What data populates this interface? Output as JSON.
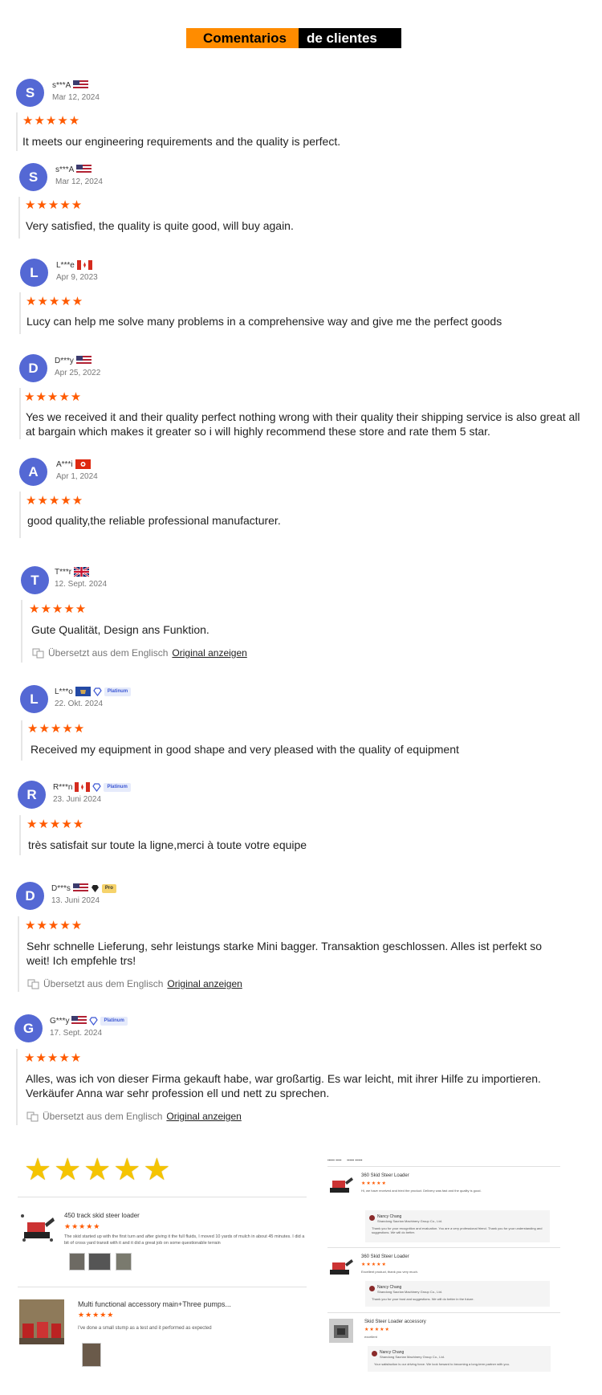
{
  "header": {
    "part1": "Comentarios",
    "part2": "de clientes"
  },
  "reviews": [
    {
      "initial": "S",
      "name": "s***A",
      "date": "Mar 12, 2024",
      "stars": "★★★★★",
      "text": "It meets our engineering requirements and the quality is perfect."
    },
    {
      "initial": "S",
      "name": "s***A",
      "date": "Mar 12, 2024",
      "stars": "★★★★★",
      "text": "Very satisfied, the quality is quite good, will buy again."
    },
    {
      "initial": "L",
      "name": "L***e",
      "date": "Apr 9, 2023",
      "stars": "★★★★★",
      "text": "Lucy can help me solve many problems in a comprehensive way and give me the perfect goods"
    },
    {
      "initial": "D",
      "name": "D***y",
      "date": "Apr 25, 2022",
      "stars": "★★★★★",
      "text": "Yes we received it and their quality perfect nothing wrong with their quality their shipping service is also great all at bargain which makes it greater so i will highly recommend these store and rate them 5 star."
    },
    {
      "initial": "A",
      "name": "A***i",
      "date": "Apr 1, 2024",
      "stars": "★★★★★",
      "text": "good quality,the reliable professional manufacturer."
    },
    {
      "initial": "T",
      "name": "T***r",
      "date": "12. Sept. 2024",
      "stars": "★★★★★",
      "text": "Gute Qualität, Design ans Funktion.",
      "translated": "Übersetzt aus dem Englisch",
      "original_link": "Original anzeigen"
    },
    {
      "initial": "L",
      "name": "L***o",
      "badge": "Platinum",
      "date": "22. Okt. 2024",
      "stars": "★★★★★",
      "text": "Received my equipment in good shape and very pleased with the quality of equipment"
    },
    {
      "initial": "R",
      "name": "R***n",
      "badge": "Platinum",
      "date": "23. Juni 2024",
      "stars": "★★★★★",
      "text": "très satisfait sur toute la ligne,merci à toute votre equipe"
    },
    {
      "initial": "D",
      "name": "D***s",
      "badge": "Pro",
      "date": "13. Juni 2024",
      "stars": "★★★★★",
      "text": "Sehr schnelle Lieferung, sehr leistungs starke Mini bagger. Transaktion geschlossen. Alles ist perfekt so weit! Ich empfehle trs!",
      "translated": "Übersetzt aus dem Englisch",
      "original_link": "Original anzeigen"
    },
    {
      "initial": "G",
      "name": "G***y",
      "badge": "Platinum",
      "date": "17. Sept. 2024",
      "stars": "★★★★★",
      "text": "Alles, was ich von dieser Firma gekauft habe, war großartig. Es war leicht, mit ihrer Hilfe zu importieren. Verkäufer Anna war sehr profession ell und nett zu sprechen.",
      "translated": "Übersetzt aus dem Englisch",
      "original_link": "Original anzeigen"
    }
  ],
  "colors": {
    "accent_orange": "#ff8c00",
    "star_orange": "#ff5a00",
    "avatar_blue": "#5468d4",
    "big_star_gold": "#f5c400"
  },
  "bottom_left": {
    "big_stars": "★★★★★",
    "items": [
      {
        "title": "450 track skid steer loader",
        "stars": "★★★★★",
        "desc": "The skid started up with the first turn and after giving it the full fluids, I moved 10 yards of mulch in about 45 minutes. I did a bit of cross yard transit with it and it did a great job on some questionable terrain"
      },
      {
        "title": "Multi functional accessory main+Three pumps...",
        "stars": "★★★★★",
        "desc": "I've done a small stump as a test and it performed as expected"
      }
    ]
  },
  "bottom_right": {
    "items": [
      {
        "title": "360 Skid Steer Loader",
        "stars": "★★★★★",
        "desc": "Hi, we have received and tried the product. Delivery was fast and the quality is good.",
        "reply": {
          "name": "Nancy Chang",
          "company": "Shandong Sacrian Machinery Group Co., Ltd.",
          "text": "Thank you for your recognition and evaluation. You are a very professional friend. Thank you for your understanding and suggestions. We will do better."
        }
      },
      {
        "title": "360 Skid Steer Loader",
        "stars": "★★★★★",
        "desc": "Excellent product, thank you very much.",
        "reply": {
          "name": "Nancy Chang",
          "company": "Shandong Sacrian Machinery Group Co., Ltd.",
          "text": "Thank you for your trust and suggestions. We will do better in the future."
        }
      },
      {
        "title": "Skid Steer Loader accessory",
        "stars": "★★★★★",
        "desc": "excellent",
        "reply": {
          "name": "Nancy Chang",
          "company": "Shandong Sacrian Machinery Group Co., Ltd.",
          "text": "Your satisfaction is our driving force. We look forward to becoming a long-term partner with you."
        }
      }
    ]
  }
}
